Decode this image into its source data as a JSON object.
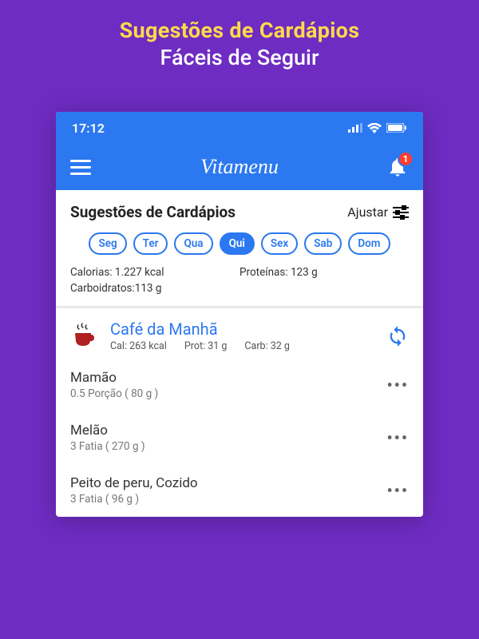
{
  "promo": {
    "line1": "Sugestões de Cardápios",
    "line2": "Fáceis de Seguir"
  },
  "status_bar": {
    "time": "17:12"
  },
  "app": {
    "title": "Vitamenu",
    "notification_count": "1"
  },
  "section": {
    "title": "Sugestões de Cardápios",
    "adjust_label": "Ajustar"
  },
  "days": [
    {
      "label": "Seg",
      "active": false
    },
    {
      "label": "Ter",
      "active": false
    },
    {
      "label": "Qua",
      "active": false
    },
    {
      "label": "Qui",
      "active": true
    },
    {
      "label": "Sex",
      "active": false
    },
    {
      "label": "Sab",
      "active": false
    },
    {
      "label": "Dom",
      "active": false
    }
  ],
  "totals": {
    "calories": "Calorias: 1.227 kcal",
    "proteins": "Proteínas: 123 g",
    "carbs": "Carboidratos:113 g"
  },
  "meal": {
    "name": "Café da Manhã",
    "cal": "Cal: 263 kcal",
    "prot": "Prot: 31 g",
    "carb": "Carb: 32 g"
  },
  "foods": [
    {
      "name": "Mamão",
      "portion": "0.5 Porção ( 80 g )"
    },
    {
      "name": "Melão",
      "portion": "3 Fatia ( 270 g )"
    },
    {
      "name": "Peito de peru, Cozido",
      "portion": "3 Fatia ( 96 g )"
    }
  ]
}
